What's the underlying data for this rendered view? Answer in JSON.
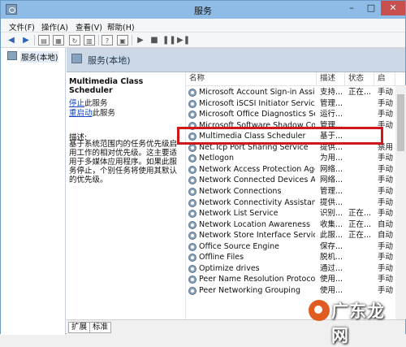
{
  "window": {
    "title": "服务"
  },
  "menu": [
    "文件(F)",
    "操作(A)",
    "查看(V)",
    "帮助(H)"
  ],
  "tree": {
    "label": "服务(本地)"
  },
  "banner": {
    "title": "服务(本地)"
  },
  "detail": {
    "title": "Multimedia Class Scheduler",
    "stop_link": "停止",
    "stop_suffix": "此服务",
    "restart_link": "重启动",
    "restart_suffix": "此服务",
    "desc_label": "描述:",
    "desc_text": "基于系统范围内的任务优先级启用工作的相对优先级。这主要适用于多媒体应用程序。如果此服务停止，个别任务将使用其默认的优先级。"
  },
  "columns": {
    "name": "名称",
    "desc": "描述",
    "status": "状态",
    "startup": "启"
  },
  "services": [
    {
      "name": "Microsoft Account Sign-in Assist...",
      "desc": "支持...",
      "status": "正在...",
      "startup": "手动"
    },
    {
      "name": "Microsoft iSCSI Initiator Service",
      "desc": "管理...",
      "status": "",
      "startup": "手动"
    },
    {
      "name": "Microsoft Office Diagnostics Serv...",
      "desc": "运行...",
      "status": "",
      "startup": "手动"
    },
    {
      "name": "Microsoft Software Shadow Cop...",
      "desc": "管理...",
      "status": "",
      "startup": "手动"
    },
    {
      "name": "Multimedia Class Scheduler",
      "desc": "基于...",
      "status": "",
      "startup": ""
    },
    {
      "name": "Net.Tcp Port Sharing Service",
      "desc": "提供...",
      "status": "",
      "startup": "禁用"
    },
    {
      "name": "Netlogon",
      "desc": "为用...",
      "status": "",
      "startup": "手动"
    },
    {
      "name": "Network Access Protection Agent",
      "desc": "网络...",
      "status": "",
      "startup": "手动"
    },
    {
      "name": "Network Connected Devices Aut...",
      "desc": "网络...",
      "status": "",
      "startup": "手动"
    },
    {
      "name": "Network Connections",
      "desc": "管理...",
      "status": "",
      "startup": "手动"
    },
    {
      "name": "Network Connectivity Assistant",
      "desc": "提供...",
      "status": "",
      "startup": "手动"
    },
    {
      "name": "Network List Service",
      "desc": "识别...",
      "status": "正在...",
      "startup": "手动"
    },
    {
      "name": "Network Location Awareness",
      "desc": "收集...",
      "status": "正在...",
      "startup": "自动"
    },
    {
      "name": "Network Store Interface Service",
      "desc": "此服...",
      "status": "正在...",
      "startup": "自动"
    },
    {
      "name": "Office Source Engine",
      "desc": "保存...",
      "status": "",
      "startup": "手动"
    },
    {
      "name": "Offline Files",
      "desc": "脱机...",
      "status": "",
      "startup": "手动"
    },
    {
      "name": "Optimize drives",
      "desc": "通过...",
      "status": "",
      "startup": "手动"
    },
    {
      "name": "Peer Name Resolution Protocol",
      "desc": "使用...",
      "status": "",
      "startup": "手动"
    },
    {
      "name": "Peer Networking Grouping",
      "desc": "使用...",
      "status": "",
      "startup": "手动"
    }
  ],
  "tabs": [
    "扩展",
    "标准"
  ],
  "watermark": {
    "text": "广东龙网"
  },
  "colors": {
    "titlebar": "#8fbce6",
    "highlight": "#d0181b",
    "link": "#1a47c2"
  }
}
